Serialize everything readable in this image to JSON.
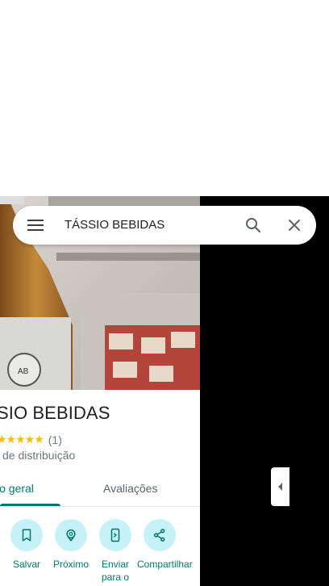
{
  "search": {
    "query": "TÁSSIO BEBIDAS"
  },
  "place": {
    "name": "TÁSSIO BEBIDAS",
    "visible_name": "SIO BEBIDAS",
    "rating_stars": 5,
    "stars_text": "★★★★★",
    "review_count": "(1)",
    "category": "de distribuição"
  },
  "tabs": [
    {
      "label": "io geral",
      "active": true
    },
    {
      "label": "Avaliações",
      "active": false
    }
  ],
  "actions": [
    {
      "label": "Salvar",
      "icon": "bookmark-icon"
    },
    {
      "label": "Próximo",
      "icon": "nearby-icon"
    },
    {
      "label": "Enviar para o",
      "icon": "send-to-phone-icon"
    },
    {
      "label": "Compartilhar",
      "icon": "share-icon"
    }
  ],
  "colors": {
    "accent": "#00796b",
    "action_bg": "#c5f1f7",
    "star": "#fbbc04",
    "map_bg": "#000000"
  }
}
